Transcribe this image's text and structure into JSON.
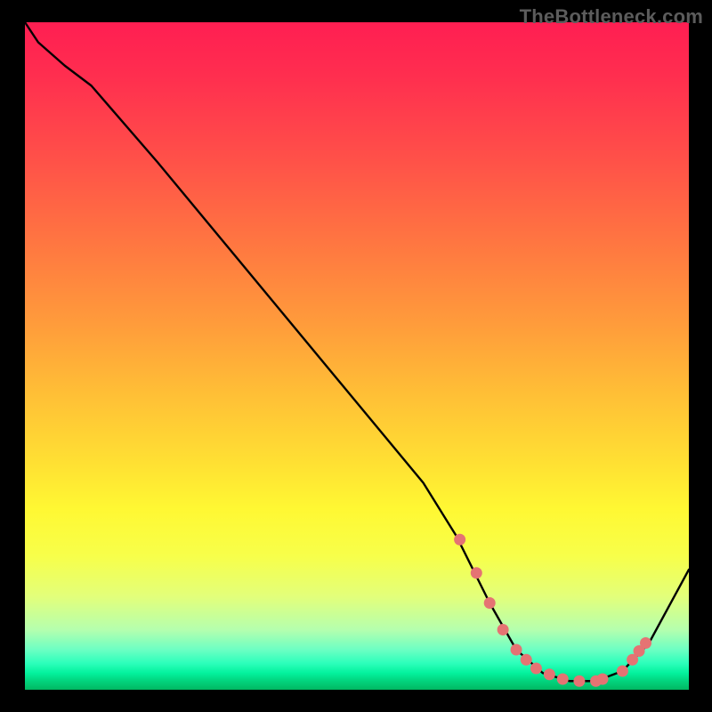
{
  "watermark": "TheBottleneck.com",
  "chart_data": {
    "type": "line",
    "title": "",
    "xlabel": "",
    "ylabel": "",
    "xlim": [
      0,
      100
    ],
    "ylim": [
      0,
      100
    ],
    "grid": false,
    "legend": false,
    "series": [
      {
        "name": "curve",
        "x": [
          0,
          2,
          6,
          10,
          20,
          30,
          40,
          50,
          60,
          65,
          68,
          70,
          74,
          78,
          82,
          86,
          90,
          94,
          100
        ],
        "y": [
          100,
          97,
          93.5,
          90.5,
          79,
          67,
          55,
          43,
          31,
          23,
          17,
          13,
          6,
          2.5,
          1.3,
          1.3,
          2.8,
          7,
          18
        ]
      }
    ],
    "markers": {
      "name": "highlight-points",
      "color": "#e57373",
      "x": [
        65.5,
        68,
        70,
        72,
        74,
        75.5,
        77,
        79,
        81,
        83.5,
        86,
        87,
        90,
        91.5,
        92.5,
        93.5
      ],
      "y": [
        22.5,
        17.5,
        13,
        9,
        6,
        4.5,
        3.2,
        2.3,
        1.6,
        1.3,
        1.3,
        1.6,
        2.8,
        4.5,
        5.8,
        7
      ]
    },
    "background_gradient": {
      "stops": [
        {
          "pos": 0.0,
          "color": "#ff1e52"
        },
        {
          "pos": 0.33,
          "color": "#ff7641"
        },
        {
          "pos": 0.66,
          "color": "#ffe033"
        },
        {
          "pos": 0.9,
          "color": "#b5ffae"
        },
        {
          "pos": 1.0,
          "color": "#01b862"
        }
      ]
    }
  }
}
